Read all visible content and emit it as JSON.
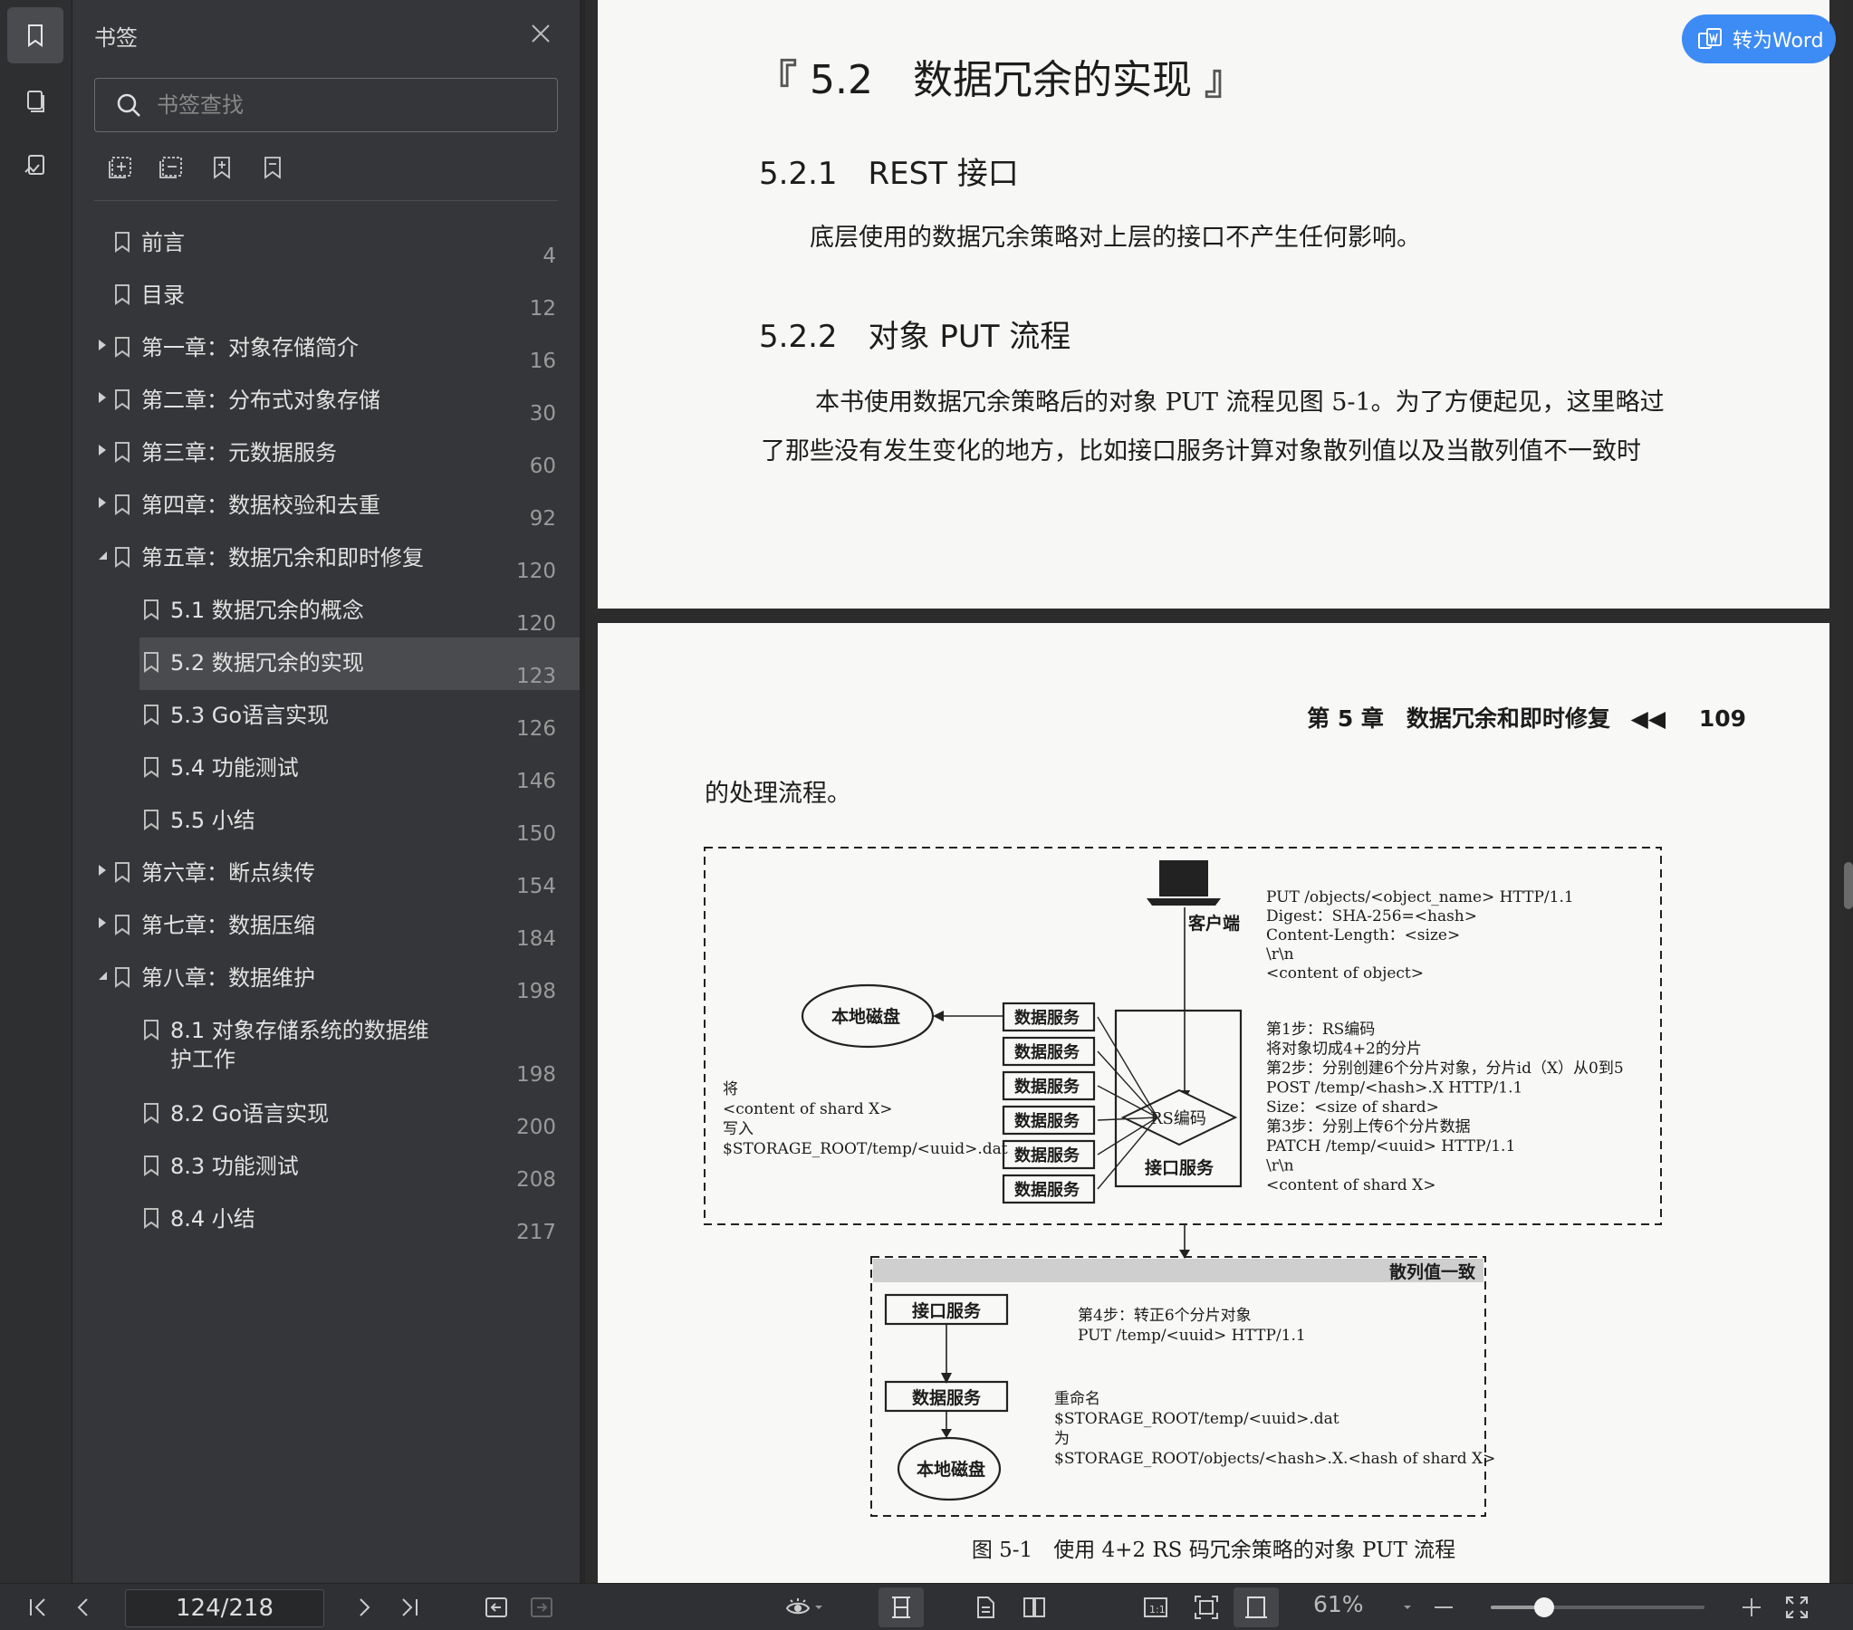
{
  "panel": {
    "title": "书签",
    "search_placeholder": "书签查找"
  },
  "bookmarks": [
    {
      "label": "前言",
      "page": "4",
      "level": 0,
      "expander": "none"
    },
    {
      "label": "目录",
      "page": "12",
      "level": 0,
      "expander": "none"
    },
    {
      "label": "第一章：对象存储简介",
      "page": "16",
      "level": 0,
      "expander": "collapsed"
    },
    {
      "label": "第二章：分布式对象存储",
      "page": "30",
      "level": 0,
      "expander": "collapsed"
    },
    {
      "label": "第三章：元数据服务",
      "page": "60",
      "level": 0,
      "expander": "collapsed"
    },
    {
      "label": "第四章：数据校验和去重",
      "page": "92",
      "level": 0,
      "expander": "collapsed"
    },
    {
      "label": "第五章：数据冗余和即时修复",
      "page": "120",
      "level": 0,
      "expander": "expanded"
    },
    {
      "label": "5.1 数据冗余的概念",
      "page": "120",
      "level": 1,
      "expander": "none"
    },
    {
      "label": "5.2 数据冗余的实现",
      "page": "123",
      "level": 1,
      "expander": "none",
      "selected": true
    },
    {
      "label": "5.3 Go语言实现",
      "page": "126",
      "level": 1,
      "expander": "none"
    },
    {
      "label": "5.4 功能测试",
      "page": "146",
      "level": 1,
      "expander": "none"
    },
    {
      "label": "5.5 小结",
      "page": "150",
      "level": 1,
      "expander": "none"
    },
    {
      "label": "第六章：断点续传",
      "page": "154",
      "level": 0,
      "expander": "collapsed"
    },
    {
      "label": "第七章：数据压缩",
      "page": "184",
      "level": 0,
      "expander": "collapsed"
    },
    {
      "label": "第八章：数据维护",
      "page": "198",
      "level": 0,
      "expander": "expanded"
    },
    {
      "label": "8.1 对象存储系统的数据维护工作",
      "page": "198",
      "level": 1,
      "expander": "none",
      "two_line": true
    },
    {
      "label": "8.2 Go语言实现",
      "page": "200",
      "level": 1,
      "expander": "none"
    },
    {
      "label": "8.3 功能测试",
      "page": "208",
      "level": 1,
      "expander": "none"
    },
    {
      "label": "8.4 小结",
      "page": "217",
      "level": 1,
      "expander": "none"
    }
  ],
  "page1": {
    "heading": "5.2　数据冗余的实现",
    "bracket_open": "『",
    "bracket_close": "』",
    "sub1": "5.2.1　REST 接口",
    "para1": "底层使用的数据冗余策略对上层的接口不产生任何影响。",
    "sub2": "5.2.2　对象 PUT 流程",
    "para2_line1": "本书使用数据冗余策略后的对象 PUT 流程见图 5-1。为了方便起见，这里略过",
    "para2_line2": "了那些没有发生变化的地方，比如接口服务计算对象散列值以及当散列值不一致时"
  },
  "page2": {
    "running_head": "第 5 章　数据冗余和即时修复",
    "running_arrows": "◀◀",
    "page_number": "109",
    "continuation": "的处理流程。",
    "caption": "图 5-1　使用 4+2 RS 码冗余策略的对象 PUT 流程",
    "diagram": {
      "client": "客户端",
      "local_disk": "本地磁盘",
      "data_service": "数据服务",
      "rs_code": "RS编码",
      "api_service": "接口服务",
      "request_lines": [
        "PUT /objects/<object_name> HTTP/1.1",
        "Digest：SHA-256=<hash>",
        "Content-Length：<size>",
        "\\r\\n",
        "<content of object>"
      ],
      "steps_lines": [
        "第1步：RS编码",
        "将对象切成4+2的分片",
        "第2步：分别创建6个分片对象，分片id（X）从0到5",
        "POST /temp/<hash>.X HTTP/1.1",
        "Size：<size of shard>",
        "第3步：分别上传6个分片数据",
        "PATCH /temp/<uuid> HTTP/1.1",
        "\\r\\n",
        "<content of shard X>"
      ],
      "write_lines": [
        "将",
        "<content of shard X>",
        "写入",
        "$STORAGE_ROOT/temp/<uuid>.dat"
      ],
      "hash_ok": "散列值一致",
      "step4_lines": [
        "第4步：转正6个分片对象",
        "PUT /temp/<uuid> HTTP/1.1"
      ],
      "rename_lines": [
        "重命名",
        "$STORAGE_ROOT/temp/<uuid>.dat",
        "为",
        "$STORAGE_ROOT/objects/<hash>.X.<hash of shard X>"
      ]
    }
  },
  "word_button": "转为Word",
  "bottombar": {
    "page_indicator": "124/218",
    "zoom": "61%",
    "zoom_fraction": 0.25,
    "accent": "#3d8bf5"
  }
}
